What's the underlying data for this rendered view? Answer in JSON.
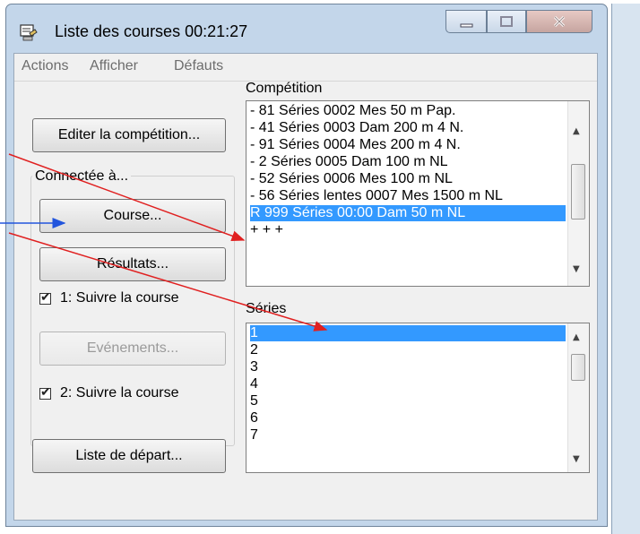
{
  "window": {
    "title": "Liste des courses  00:21:27"
  },
  "menu": [
    "Actions",
    "Afficher",
    "Défauts"
  ],
  "left_panel": {
    "edit_button": "Editer la compétition...",
    "group_label": "Connectée à...",
    "course_button": "Course...",
    "results_button": "Résultats...",
    "follow1_label": "1: Suivre la course",
    "events_button": "Evénements...",
    "follow2_label": "2: Suivre la course",
    "start_list_button": "Liste de départ..."
  },
  "competition": {
    "label": "Compétition",
    "items": [
      "- 81 Séries 0002 Mes 50 m Pap.",
      "- 41 Séries 0003 Dam 200 m 4 N.",
      "- 91 Séries 0004 Mes 200 m 4 N.",
      "- 2 Séries 0005 Dam 100 m NL",
      "- 52 Séries 0006 Mes 100 m NL",
      "- 56 Séries lentes 0007 Mes 1500 m NL",
      "R 999 Séries 00:00 Dam 50 m NL",
      "+ + +"
    ],
    "selected_index": 6
  },
  "series": {
    "label": "Séries",
    "items": [
      "1",
      "2",
      "3",
      "4",
      "5",
      "6",
      "7"
    ],
    "selected_index": 0
  },
  "colors": {
    "selection": "#3399ff",
    "arrow_red": "#e02020",
    "arrow_blue": "#2255dd"
  }
}
